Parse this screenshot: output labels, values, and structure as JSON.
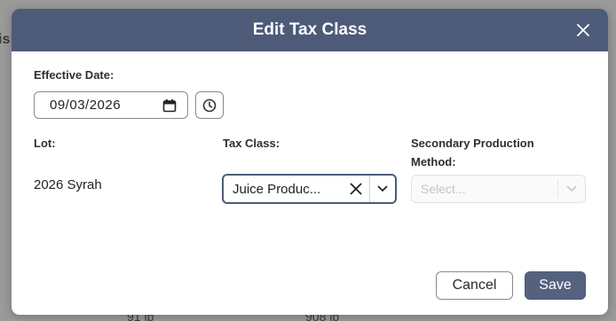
{
  "background": {
    "partial_left": "is",
    "partial_bottom_1": "91 lb",
    "partial_bottom_2": "908 lb"
  },
  "modal": {
    "title": "Edit Tax Class",
    "close_icon": "close-icon",
    "effective_date": {
      "label": "Effective Date:",
      "value": "09/03/2026",
      "calendar_icon": "calendar-icon",
      "clock_icon": "clock-icon"
    },
    "lot": {
      "label": "Lot:",
      "value": "2026 Syrah"
    },
    "tax_class": {
      "label": "Tax Class:",
      "value": "Juice Produc...",
      "clear_icon": "clear-icon",
      "chevron_icon": "chevron-down-icon"
    },
    "secondary_production_method": {
      "label_line1": "Secondary Production",
      "label_line2": "Method:",
      "placeholder": "Select..."
    },
    "buttons": {
      "cancel": "Cancel",
      "save": "Save"
    }
  },
  "colors": {
    "header": "#4d5a78",
    "save_button": "#55627f",
    "backdrop": "#9a9a9a"
  }
}
